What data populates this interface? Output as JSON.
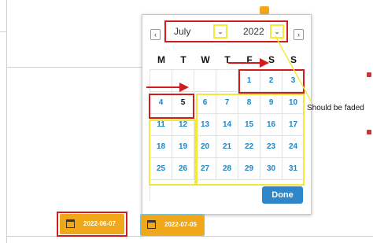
{
  "calendar": {
    "month": "July",
    "year": "2022",
    "prev_icon": "chevron-left",
    "next_icon": "chevron-right",
    "weekdays": [
      "M",
      "T",
      "W",
      "T",
      "F",
      "S",
      "S"
    ],
    "weeks": [
      [
        "",
        "",
        "",
        "",
        "1",
        "2",
        "3"
      ],
      [
        "4",
        "5",
        "6",
        "7",
        "8",
        "9",
        "10"
      ],
      [
        "11",
        "12",
        "13",
        "14",
        "15",
        "16",
        "17"
      ],
      [
        "18",
        "19",
        "20",
        "21",
        "22",
        "23",
        "24"
      ],
      [
        "25",
        "26",
        "27",
        "28",
        "29",
        "30",
        "31"
      ]
    ],
    "selected_day": "5",
    "done_label": "Done"
  },
  "date_range": {
    "start": "2022-06-07",
    "end": "2022-07-05",
    "icon": "calendar-icon"
  },
  "annotation": "Should be faded",
  "colors": {
    "accent": "#2f86c8",
    "date_button": "#f0a81a",
    "highlight_red": "#d01c1c",
    "highlight_yellow": "#f2e93a"
  }
}
